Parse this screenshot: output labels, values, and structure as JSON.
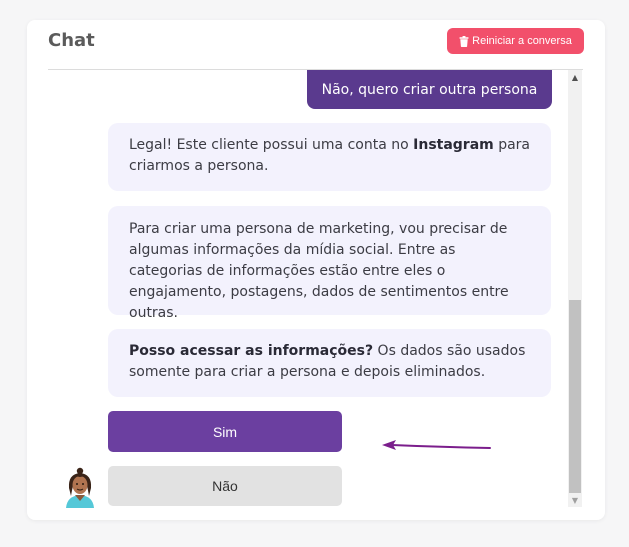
{
  "header": {
    "title": "Chat",
    "reset_label": "Reiniciar a conversa"
  },
  "messages": {
    "user_reply": "Não, quero criar outra persona",
    "bot_1": {
      "before": "Legal! Este cliente possui uma conta no ",
      "bold": "Instagram",
      "after": " para criarmos a persona."
    },
    "bot_2": "Para criar uma persona de marketing, vou precisar de algumas informações da mídia social. Entre as categorias de informações estão entre eles o engajamento, postagens, dados de sentimentos entre outras.",
    "bot_3": {
      "bold": "Posso acessar as informações?",
      "after": " Os dados são usados somente para criar a persona e depois eliminados."
    }
  },
  "options": {
    "yes_label": "Sim",
    "no_label": "Não"
  },
  "colors": {
    "accent_purple": "#6b3fa0",
    "user_bubble": "#5a3a8e",
    "bot_bubble": "#f3f2fd",
    "reset_red": "#f2506b",
    "arrow": "#7b1e8c"
  },
  "icons": {
    "reset": "trash-icon",
    "bot": "bot-avatar",
    "pointer": "arrow-left-icon"
  }
}
